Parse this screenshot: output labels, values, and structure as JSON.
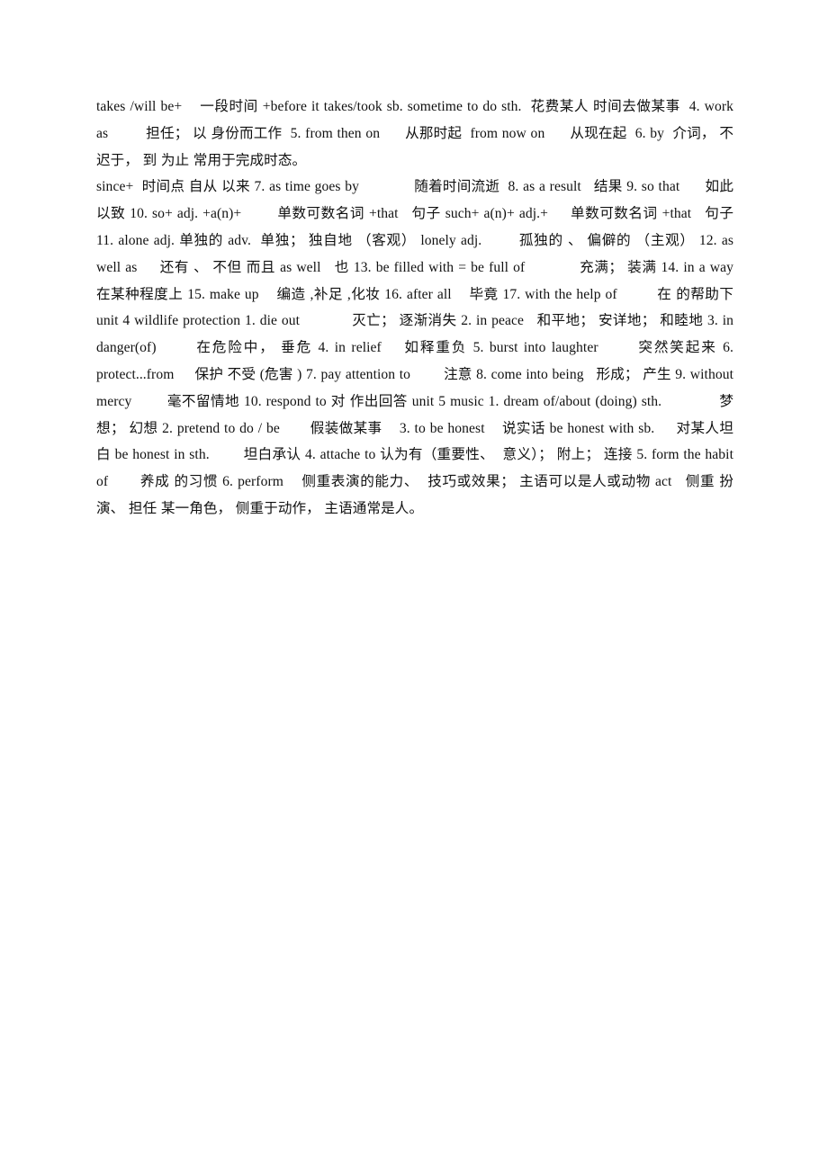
{
  "document": {
    "page_background": "#ffffff",
    "text_color": "#111111",
    "paragraphs": [
      {
        "id": "para-1",
        "text": "takes /will be+    一段时间 +before it takes/took sb. sometime to do sth.  花费某人 时间去做某事  4. work as         担任； 以 身份而工作  5. from then on      从那时起  from now on      从现在起  6. by  介词， 不迟于， 到 为止 常用于完成时态。"
      },
      {
        "id": "para-2",
        "text": "since+  时间点 自从 以来 7. as time goes by             随着时间流逝  8. as a result   结果 9. so that      如此 以致 10. so+ adj. +a(n)+        单数可数名词 +that   句子 such+ a(n)+ adj.+     单数可数名词 +that   句子 11. alone adj. 单独的 adv.  单独； 独自地 （客观） lonely adj.        孤独的 、 偏僻的 （主观） 12. as well as     还有 、 不但 而且 as well   也 13. be filled with = be full of            充满； 装满 14. in a way   在某种程度上 15. make up    编造 ,补足 ,化妆 16. after all    毕竟 17. with the help of         在 的帮助下  unit 4 wildlife protection 1. die out            灭亡； 逐渐消失 2. in peace   和平地； 安详地； 和睦地 3. in danger(of)       在危险中， 垂危 4. in relief    如释重负 5. burst into laughter       突然笑起来 6. protect...from     保护 不受 (危害 ) 7. pay attention to        注意 8. come into being   形成； 产生 9. without mercy        毫不留情地 10. respond to 对 作出回答 unit 5 music 1. dream of/about (doing) sth.             梦想； 幻想 2. pretend to do / be       假装做某事    3. to be honest    说实话 be honest with sb.     对某人坦白 be honest in sth.        坦白承认 4. attache to 认为有（重要性、  意义）； 附上； 连接 5. form the habit of       养成 的习惯 6. perform    侧重表演的能力、  技巧或效果； 主语可以是人或动物 act   侧重 扮演、 担任 某一角色， 侧重于动作， 主语通常是人。"
      }
    ]
  }
}
